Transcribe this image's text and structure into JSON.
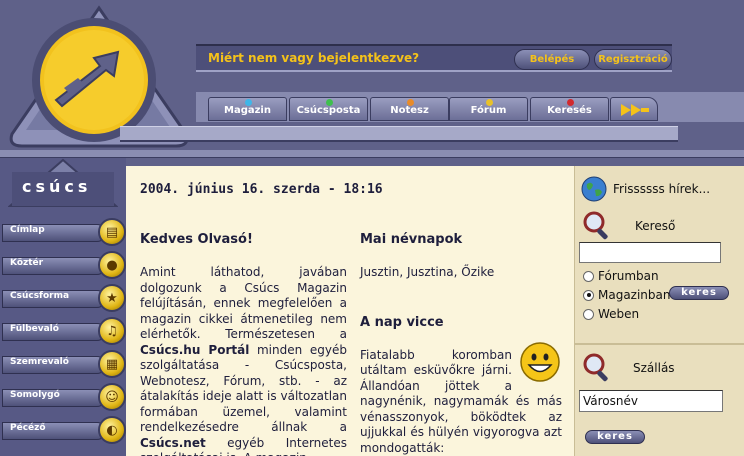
{
  "header": {
    "login_prompt": "Miért nem vagy bejelentkezve?",
    "login_label": "Belépés",
    "register_label": "Regisztráció",
    "tabs": [
      {
        "label": "Magazin",
        "led": "#3fb6e8"
      },
      {
        "label": "Csúcsposta",
        "led": "#3fbf4f"
      },
      {
        "label": "Notesz",
        "led": "#e88b2a"
      },
      {
        "label": "Fórum",
        "led": "#e8c12a"
      },
      {
        "label": "Keresés",
        "led": "#d2292e"
      }
    ],
    "more_icon": "double-arrow-right-icon"
  },
  "sidebar": {
    "brand": "csúcs",
    "items": [
      {
        "label": "Címlap",
        "icon": "book-icon",
        "glyph": "▤"
      },
      {
        "label": "Köztér",
        "icon": "microphone-icon",
        "glyph": "●"
      },
      {
        "label": "Csúcsforma",
        "icon": "runner-icon",
        "glyph": "★"
      },
      {
        "label": "Fülbevaló",
        "icon": "music-note-icon",
        "glyph": "♫"
      },
      {
        "label": "Szemrevaló",
        "icon": "picture-icon",
        "glyph": "▦"
      },
      {
        "label": "Somolygó",
        "icon": "smiley-icon",
        "glyph": "☺"
      },
      {
        "label": "Pécéző",
        "icon": "mouse-icon",
        "glyph": "◐"
      }
    ]
  },
  "main": {
    "date": "2004. június 16. szerda - 18:16",
    "greeting_title": "Kedves Olvasó!",
    "greeting_text_1": "Amint láthatod, javában dolgozunk a Csúcs Magazin felújításán, ennek megfelelően a magazin cikkei átmenetileg nem elérhetők. Természetesen a ",
    "greeting_bold_1": "Csúcs.hu Portál",
    "greeting_text_2": " minden egyéb szolgáltatása - Csúcsposta, Webnotesz, Fórum, stb. - az átalakítás ideje alatt is változatlan formában üzemel, valamint rendelkezésedre állnak a ",
    "greeting_bold_2": "Csúcs.net",
    "greeting_text_3": " egyéb Internetes szolgáltatásai is. A magazin",
    "namedays_title": "Mai névnapok",
    "namedays": "Jusztin, Jusztina, Őzike",
    "joke_title": "A nap vicce",
    "joke": "Fiatalabb koromban utáltam esküvőkre járni. Állandóan jöttek a nagynénik, nagymamák és más vénasszonyok, böködtek az ujjukkal és hülyén vigyorogva azt mondogatták:"
  },
  "right": {
    "news_label": "Frissssss hírek...",
    "search_title": "Kereső",
    "search_value": "",
    "radios": [
      {
        "label": "Fórumban",
        "checked": false
      },
      {
        "label": "Magazinban",
        "checked": true
      },
      {
        "label": "Weben",
        "checked": false
      }
    ],
    "search_button": "keres",
    "lodging_title": "Szállás",
    "city_placeholder": "Városnév",
    "lodging_button": "keres"
  },
  "colors": {
    "frame": "#5f6189",
    "accent_yellow": "#f4c21a",
    "content_bg": "#fbf5dc",
    "right_bg": "#e9dfbe"
  }
}
